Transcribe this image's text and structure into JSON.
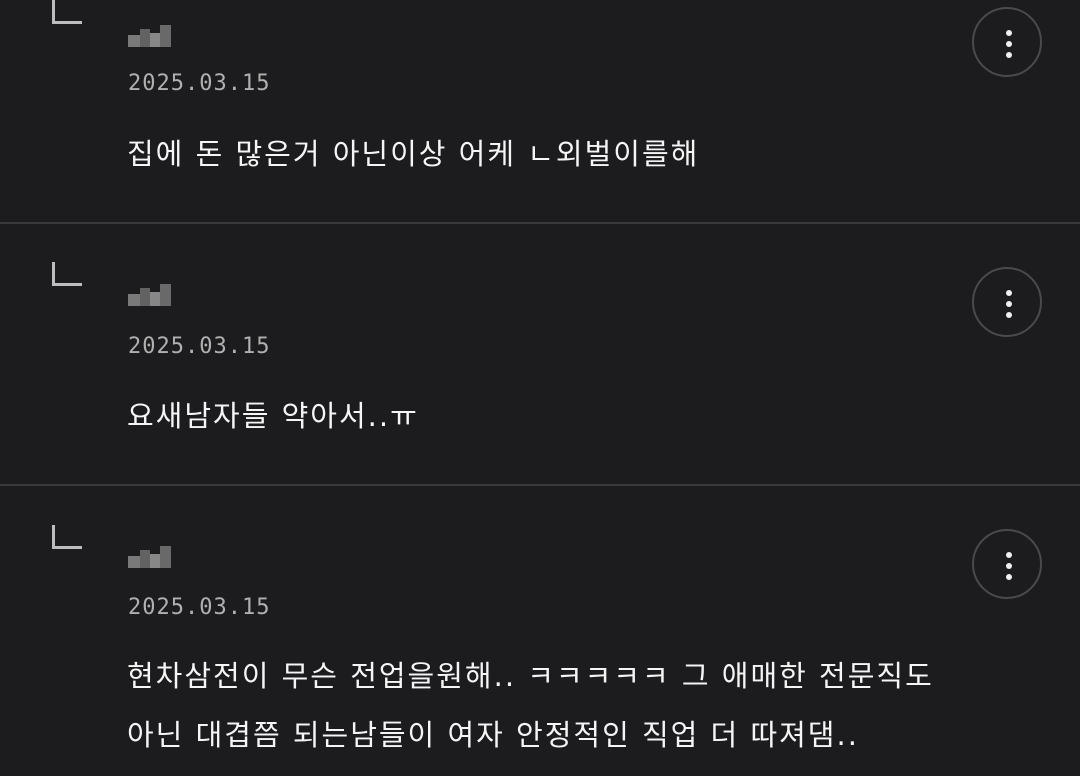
{
  "replies": [
    {
      "date": "2025.03.15",
      "text": "집에 돈 많은거 아닌이상 어케 ㄴ외벌이를해",
      "more_icon": "more-vertical-icon"
    },
    {
      "date": "2025.03.15",
      "text": "요새남자들 약아서..ㅠ",
      "more_icon": "more-vertical-icon"
    },
    {
      "date": "2025.03.15",
      "lines": [
        "현차삼전이 무슨 전업을원해.. ㅋㅋㅋㅋㅋ 그 애매한 전문직도",
        "아닌 대겹쯤 되는남들이 여자 안정적인 직업 더 따져댐.."
      ],
      "more_icon": "more-vertical-icon"
    }
  ],
  "colors": {
    "background": "#1c1c1e",
    "divider": "#3a3a3d",
    "text": "#f5f5f5",
    "date": "#b0b0b0"
  }
}
